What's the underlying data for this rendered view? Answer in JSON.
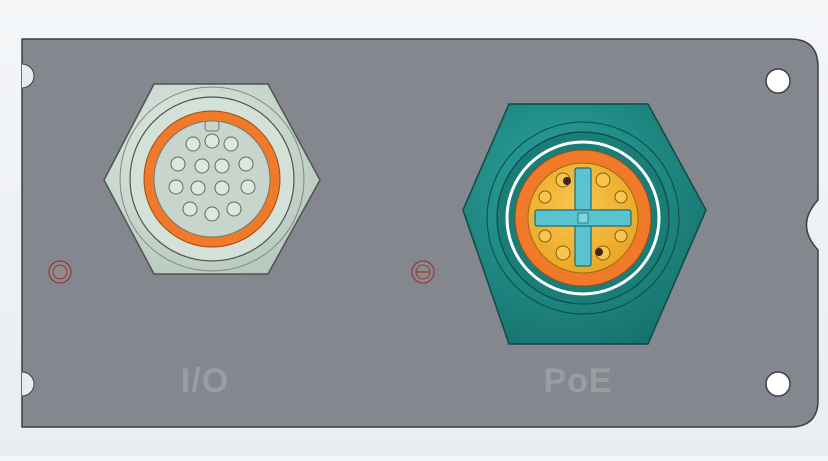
{
  "panel": {
    "labels": {
      "io": "I/O",
      "poe": "PoE"
    }
  },
  "colors": {
    "plate": "#84878d",
    "plate_edge": "#3d4046",
    "label_text": "#9a9ea4",
    "io_nut": "#c9d7cf",
    "io_ring": "#f07a2a",
    "poe_nut": "#1f8a84",
    "poe_ring": "#f07a2a",
    "poe_insert": "#f4b430",
    "poe_cross": "#59c3cf"
  },
  "icons": [
    "io-connector-icon",
    "poe-connector-icon",
    "screw-icon",
    "mounting-hole-icon"
  ]
}
